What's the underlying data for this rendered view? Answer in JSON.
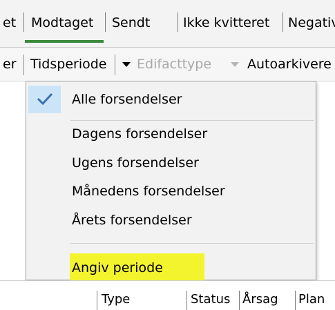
{
  "tabs": {
    "partial_left": "et",
    "received": "Modtaget",
    "sent": "Sendt",
    "not_acknowledged": "Ikke kvitteret",
    "negative_partial": "Negativ"
  },
  "toolbar": {
    "partial_left": "er",
    "time_period": "Tidsperiode",
    "edifact_type": "Edifacttype",
    "auto_archive": "Autoarkivere"
  },
  "menu": {
    "items": {
      "all": "Alle forsendelser",
      "today": "Dagens forsendelser",
      "week": "Ugens forsendelser",
      "month": "Månedens forsendelser",
      "year": "Årets forsendelser",
      "specify": "Angiv periode"
    },
    "selected": "all",
    "highlight_color": "#f4f42e",
    "check_bg_color": "#cce4f7"
  },
  "grid_columns": {
    "type": "Type",
    "status": "Status",
    "reason": "Årsag",
    "plan_partial": "Plan"
  },
  "icons": {
    "check": "check-icon",
    "dropdown": "chevron-down-icon"
  },
  "colors": {
    "active_tab_underline": "#3c8a3c"
  }
}
